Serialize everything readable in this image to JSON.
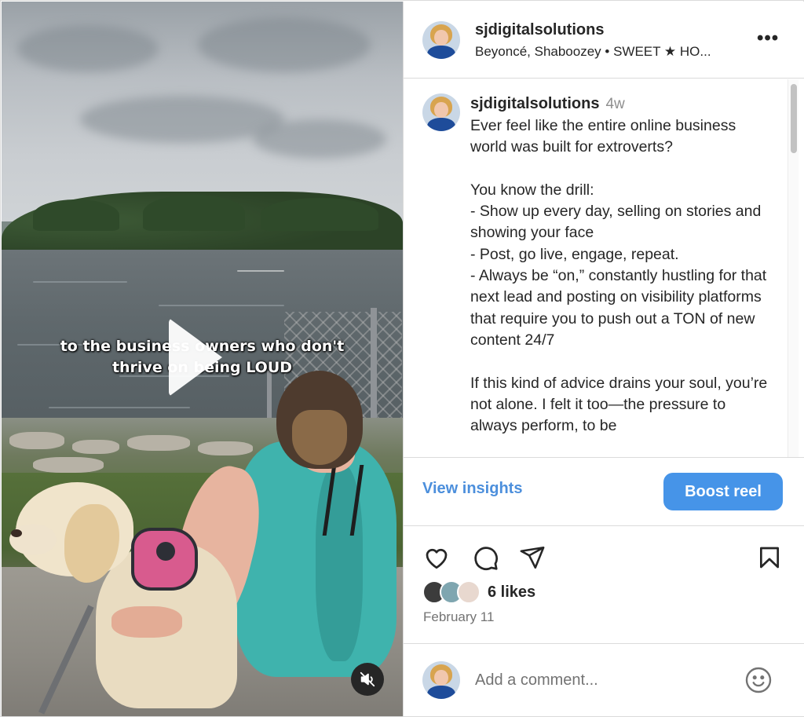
{
  "video": {
    "caption_line1": "to the business owners who don't",
    "caption_line2": "thrive on being LOUD",
    "play_icon": "play-icon",
    "mute_icon": "muted-speaker-icon"
  },
  "post": {
    "username": "sjdigitalsolutions",
    "music": "Beyoncé, Shaboozey • SWEET ★ HO...",
    "more_icon": "more-options-icon",
    "more_label": "•••"
  },
  "caption": {
    "username": "sjdigitalsolutions",
    "time": "4w",
    "text": "Ever feel like the entire online business world was built for extroverts?\n\nYou know the drill:\n- Show up every day, selling on stories and showing your face\n- Post, go live, engage, repeat.\n- Always be “on,” constantly hustling for that next lead and posting on visibility platforms that require you to push out a TON of new content 24/7\n\nIf this kind of advice drains your soul, you’re not alone. I felt it too—the pressure to always perform, to be"
  },
  "insights": {
    "view_label": "View insights",
    "boost_label": "Boost reel"
  },
  "actions": {
    "icons": [
      "heart-icon",
      "comment-icon",
      "share-icon",
      "bookmark-icon"
    ],
    "likes": "6 likes",
    "date": "February 11"
  },
  "comment_box": {
    "placeholder": "Add a comment...",
    "emoji_icon": "emoji-icon"
  },
  "colors": {
    "accent": "#4694e8",
    "link": "#4c8fdc",
    "secondary_text": "#737373",
    "border": "#dbdbdb"
  }
}
